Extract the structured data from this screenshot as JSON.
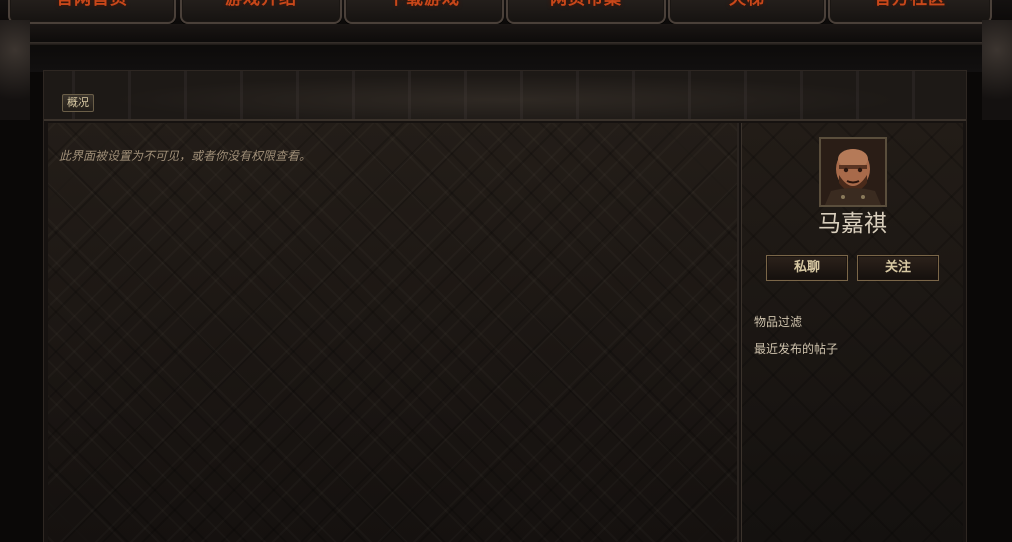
{
  "nav": {
    "items": [
      "官网首页",
      "游戏介绍",
      "下载游戏",
      "网页市集",
      "天梯",
      "官方社区"
    ]
  },
  "panel": {
    "tab_overview": "概况",
    "notice": "此界面被设置为不可见，或者你没有权限查看。"
  },
  "profile": {
    "username": "马嘉祺",
    "chat_button": "私聊",
    "follow_button": "关注",
    "links": [
      "物品过滤",
      "最近发布的帖子"
    ]
  },
  "colors": {
    "nav_text": "#c8471a",
    "accent_border": "#7a6648",
    "text_light": "#d9cfbd"
  }
}
